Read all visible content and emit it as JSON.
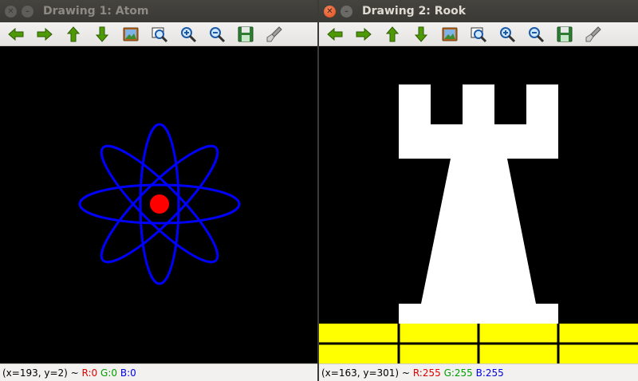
{
  "windows": [
    {
      "id": "left",
      "title": "Drawing 1: Atom",
      "active": false,
      "status": {
        "coords": "(x=193, y=2) ~",
        "r": "R:0",
        "g": "G:0",
        "b": "B:0"
      }
    },
    {
      "id": "right",
      "title": "Drawing 2: Rook",
      "active": true,
      "status": {
        "coords": "(x=163, y=301) ~",
        "r": "R:255",
        "g": "G:255",
        "b": "B:255"
      }
    }
  ],
  "toolbar_icons": [
    "arrow-left-icon",
    "arrow-right-icon",
    "arrow-up-icon",
    "arrow-down-icon",
    "image-icon",
    "zoom-fit-icon",
    "zoom-in-icon",
    "zoom-out-icon",
    "save-icon",
    "brush-icon"
  ],
  "colors": {
    "atom_orbit": "#0000ff",
    "atom_nucleus": "#ff0000",
    "rook": "#ffffff",
    "floor": "#ffff00",
    "floor_lines": "#000000",
    "canvas_bg": "#000000"
  }
}
